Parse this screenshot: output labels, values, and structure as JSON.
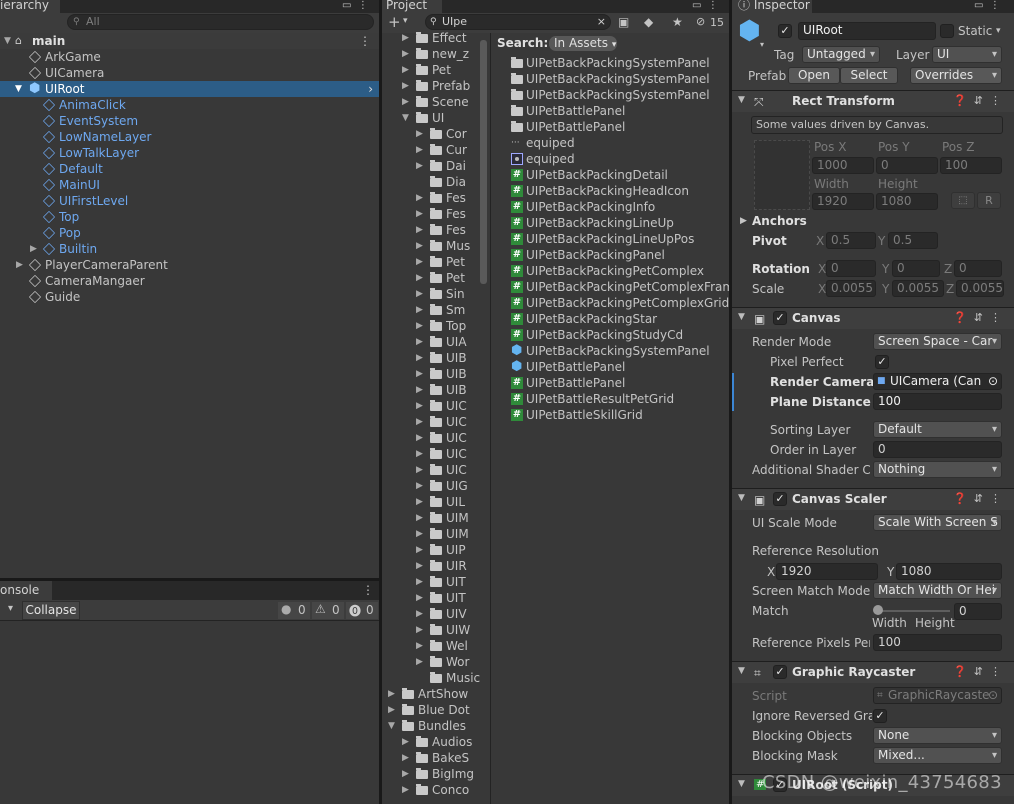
{
  "hierarchy": {
    "tab": "ierarchy",
    "search_placeholder": "All",
    "scene": "main",
    "items": [
      "ArkGame",
      "UICamera",
      "UIRoot",
      "AnimaClick",
      "EventSystem",
      "LowNameLayer",
      "LowTalkLayer",
      "Default",
      "MainUI",
      "UIFirstLevel",
      "Top",
      "Pop",
      "Builtin",
      "PlayerCameraParent",
      "CameraMangaer",
      "Guide"
    ]
  },
  "console": {
    "tab": "onsole",
    "collapse": "Collapse",
    "counts": [
      "0",
      "0",
      "0"
    ]
  },
  "project": {
    "tab": "Project",
    "search": "UIpe",
    "filter_count": "15",
    "search_label": "Search:",
    "search_scope": "In Assets",
    "tree": [
      "Effect",
      "new_z",
      "Pet",
      "Prefab",
      "Scene",
      "UI",
      "Cor",
      "Cur",
      "Dai",
      "Dia",
      "Fes",
      "Fes",
      "Fes",
      "Mus",
      "Pet",
      "Pet",
      "Sin",
      "Sm",
      "Top",
      "UIA",
      "UIB",
      "UIB",
      "UIB",
      "UIC",
      "UIC",
      "UIC",
      "UIC",
      "UIC",
      "UIG",
      "UIL",
      "UIM",
      "UIM",
      "UIP",
      "UIR",
      "UIT",
      "UIT",
      "UIV",
      "UIW",
      "Wel",
      "Wor",
      "Music",
      "ArtShow",
      "Blue Dot",
      "Bundles",
      "Audios",
      "BakeS",
      "BigImg",
      "Conco"
    ],
    "results": [
      "UIPetBackPackingSystemPanel",
      "UIPetBackPackingSystemPanel",
      "UIPetBackPackingSystemPanel",
      "UIPetBattlePanel",
      "UIPetBattlePanel",
      "equiped",
      "equiped",
      "UIPetBackPackingDetail",
      "UIPetBackPackingHeadIcon",
      "UIPetBackPackingInfo",
      "UIPetBackPackingLineUp",
      "UIPetBackPackingLineUpPos",
      "UIPetBackPackingPanel",
      "UIPetBackPackingPetComplex",
      "UIPetBackPackingPetComplexFrame",
      "UIPetBackPackingPetComplexGrid",
      "UIPetBackPackingStar",
      "UIPetBackPackingStudyCd",
      "UIPetBackPackingSystemPanel",
      "UIPetBattlePanel",
      "UIPetBattlePanel",
      "UIPetBattleResultPetGrid",
      "UIPetBattleSkillGrid"
    ]
  },
  "inspector": {
    "tab": "Inspector",
    "name": "UIRoot",
    "static": "Static",
    "tag_label": "Tag",
    "tag": "Untagged",
    "layer_label": "Layer",
    "layer": "UI",
    "prefab_label": "Prefab",
    "open": "Open",
    "select": "Select",
    "overrides": "Overrides",
    "rect": {
      "title": "Rect Transform",
      "note": "Some values driven by Canvas.",
      "posx_l": "Pos X",
      "posy_l": "Pos Y",
      "posz_l": "Pos Z",
      "posx": "1000",
      "posy": "0",
      "posz": "100",
      "width_l": "Width",
      "height_l": "Height",
      "width": "1920",
      "height": "1080",
      "r": "R",
      "anchors": "Anchors",
      "pivot": "Pivot",
      "pivot_x": "0.5",
      "pivot_y": "0.5",
      "rotation": "Rotation",
      "rot_x": "0",
      "rot_y": "0",
      "rot_z": "0",
      "scale": "Scale",
      "sc_x": "0.0055",
      "sc_y": "0.0055",
      "sc_z": "0.0055",
      "x": "X",
      "y": "Y",
      "z": "Z"
    },
    "canvas": {
      "title": "Canvas",
      "render_mode_l": "Render Mode",
      "render_mode": "Screen Space - Car",
      "pixel_perfect_l": "Pixel Perfect",
      "render_camera_l": "Render Camera",
      "render_camera": "UICamera (Can",
      "plane_distance_l": "Plane Distance",
      "plane_distance": "100",
      "sorting_layer_l": "Sorting Layer",
      "sorting_layer": "Default",
      "order_l": "Order in Layer",
      "order": "0",
      "shader_l": "Additional Shader Ch",
      "shader": "Nothing"
    },
    "scaler": {
      "title": "Canvas Scaler",
      "mode_l": "UI Scale Mode",
      "mode": "Scale With Screen S",
      "ref_l": "Reference Resolution",
      "ref_x": "1920",
      "ref_y": "1080",
      "match_mode_l": "Screen Match Mode",
      "match_mode": "Match Width Or Hei",
      "match_l": "Match",
      "match": "0",
      "width": "Width",
      "height": "Height",
      "ppu_l": "Reference Pixels Per",
      "ppu": "100"
    },
    "raycaster": {
      "title": "Graphic Raycaster",
      "script_l": "Script",
      "script": "GraphicRaycaste",
      "ignore_l": "Ignore Reversed Grap",
      "blocking_l": "Blocking Objects",
      "blocking": "None",
      "mask_l": "Blocking Mask",
      "mask": "Mixed..."
    },
    "next": "UIRoot (Script)"
  },
  "watermark": "CSDN @weixin_43754683"
}
